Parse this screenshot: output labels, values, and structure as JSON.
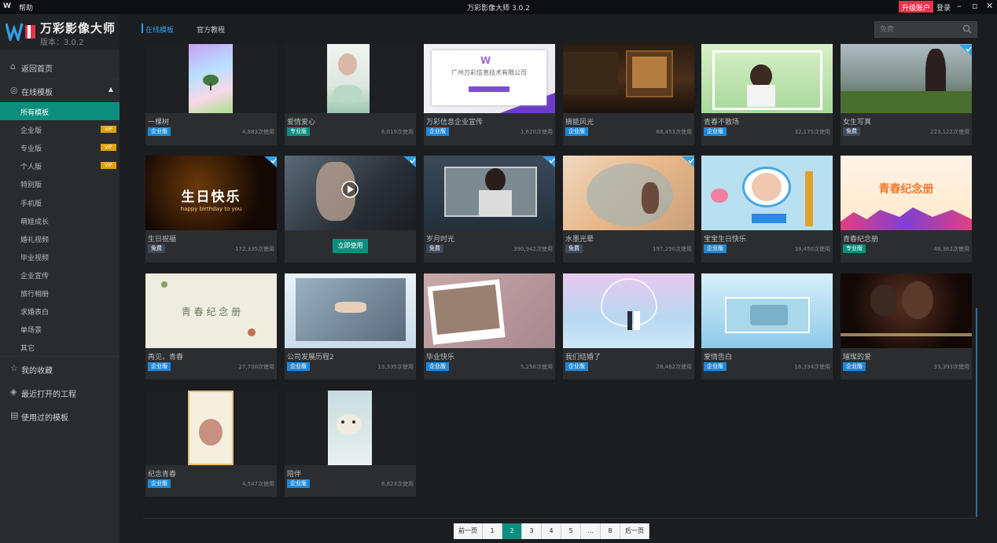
{
  "topbar": {
    "logo": "W",
    "help": "帮助",
    "title": "万彩影像大师 3.0.2",
    "upgrade": "升级账户",
    "login": "登录"
  },
  "brand": {
    "name": "万彩影像大师",
    "version": "版本：3.0.2"
  },
  "sidebar": {
    "home": "返回首页",
    "online": "在线模板",
    "items": [
      {
        "label": "所有模板",
        "vip": false
      },
      {
        "label": "企业版",
        "vip": true
      },
      {
        "label": "专业版",
        "vip": true
      },
      {
        "label": "个人版",
        "vip": true
      },
      {
        "label": "特别版",
        "vip": false
      },
      {
        "label": "手机版",
        "vip": false
      },
      {
        "label": "萌娃成长",
        "vip": false
      },
      {
        "label": "婚礼视频",
        "vip": false
      },
      {
        "label": "毕业视频",
        "vip": false
      },
      {
        "label": "企业宣传",
        "vip": false
      },
      {
        "label": "旅行相册",
        "vip": false
      },
      {
        "label": "求婚表白",
        "vip": false
      },
      {
        "label": "单场景",
        "vip": false
      },
      {
        "label": "其它",
        "vip": false
      }
    ],
    "vip_label": "VIP",
    "favorites": "我的收藏",
    "recent": "最近打开的工程",
    "used": "使用过的模板"
  },
  "tabs": {
    "online": "在线模板",
    "tutorial": "官方教程"
  },
  "search": {
    "placeholder": "免费"
  },
  "cards": [
    {
      "title": "一棵树",
      "badge": "企业版",
      "uses": "4,883次使用"
    },
    {
      "title": "爱情爱心",
      "badge": "专业版",
      "uses": "6,019次使用"
    },
    {
      "title": "万彩信息企业宣传",
      "badge": "企业版",
      "uses": "1,620次使用"
    },
    {
      "title": "摘能风光",
      "badge": "企业版",
      "uses": "68,453次使用"
    },
    {
      "title": "青春不散场",
      "badge": "企业版",
      "uses": "32,175次使用"
    },
    {
      "title": "女生写真",
      "badge": "免费",
      "uses": "223,122次使用"
    },
    {
      "title": "生日祝福",
      "badge": "免费",
      "uses": "172,335次使用"
    },
    {
      "title": "",
      "badge": "",
      "uses": ""
    },
    {
      "title": "岁月时光",
      "badge": "免费",
      "uses": "390,942次使用"
    },
    {
      "title": "水墨光晕",
      "badge": "免费",
      "uses": "197,250次使用"
    },
    {
      "title": "宝宝生日快乐",
      "badge": "企业版",
      "uses": "38,450次使用"
    },
    {
      "title": "青春纪念册",
      "badge": "专业版",
      "uses": "46,362次使用"
    },
    {
      "title": "再见，青春",
      "badge": "企业版",
      "uses": "27,700次使用"
    },
    {
      "title": "公司发展历程2",
      "badge": "企业版",
      "uses": "13,335次使用"
    },
    {
      "title": "毕业快乐",
      "badge": "企业版",
      "uses": "5,258次使用"
    },
    {
      "title": "我们结婚了",
      "badge": "企业版",
      "uses": "28,462次使用"
    },
    {
      "title": "爱情告白",
      "badge": "企业版",
      "uses": "16,334次使用"
    },
    {
      "title": "璀璨的爱",
      "badge": "企业版",
      "uses": "33,393次使用"
    },
    {
      "title": "纪念青春",
      "badge": "企业版",
      "uses": "4,547次使用"
    },
    {
      "title": "陪伴",
      "badge": "企业版",
      "uses": "6,823次使用"
    }
  ],
  "thumb_text": {
    "company": "广州万彩信息技术有限公司",
    "birthday": "生日快乐",
    "birthday_en": "happy birthday to you",
    "youth_book": "青春纪念册",
    "goodbye": "青 春 纪 念 册"
  },
  "use_button": "立即使用",
  "pager": [
    "前一页",
    "1",
    "2",
    "3",
    "4",
    "5",
    "...",
    "8",
    "后一页"
  ],
  "pager_active": "2",
  "colors": {
    "accent": "#0c8f7e",
    "link": "#2fa1ea",
    "badge_enterprise": "#1e88d8",
    "badge_pro": "#0c8f7e",
    "badge_free": "#3d4a5e",
    "vip": "#e2a10c",
    "upgrade": "#e8344a"
  }
}
